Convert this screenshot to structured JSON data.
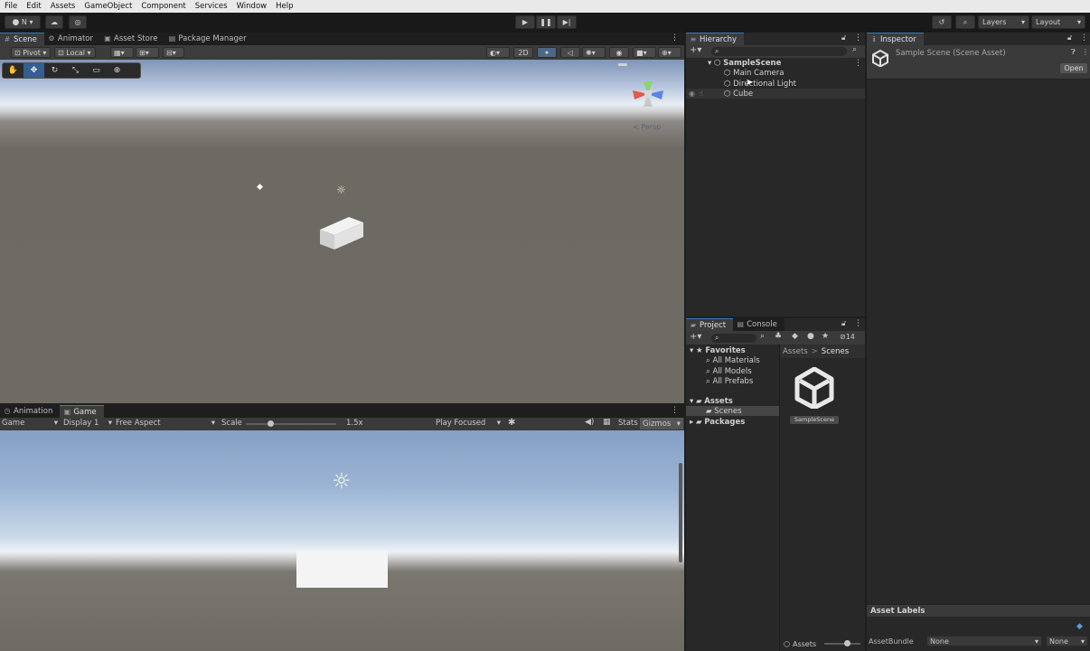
{
  "menu": [
    "File",
    "Edit",
    "Assets",
    "GameObject",
    "Component",
    "Services",
    "Window",
    "Help"
  ],
  "toolbar": {
    "account": "N",
    "layers": "Layers",
    "layout": "Layout"
  },
  "scene_tabs": [
    "Scene",
    "Animator",
    "Asset Store",
    "Package Manager"
  ],
  "scene_toolbar": {
    "pivot": "Pivot",
    "local": "Local",
    "mode_2d": "2D"
  },
  "scene_view": {
    "persp_label": "< Persp"
  },
  "game_tabs": [
    "Animation",
    "Game"
  ],
  "game_toolbar": {
    "game_dropdown": "Game",
    "display": "Display 1",
    "aspect": "Free Aspect",
    "scale_label": "Scale",
    "scale_value": "1.5x",
    "play_focused": "Play Focused",
    "stats": "Stats",
    "gizmos": "Gizmos"
  },
  "hierarchy": {
    "title": "Hierarchy",
    "search_placeholder": "",
    "scene": "SampleScene",
    "items": [
      "Main Camera",
      "Directional Light",
      "Cube"
    ]
  },
  "inspector": {
    "title": "Inspector",
    "asset_title": "Sample Scene (Scene Asset)",
    "open_button": "Open",
    "asset_labels": "Asset Labels",
    "asset_bundle_label": "AssetBundle",
    "asset_bundle_value": "None",
    "asset_bundle_variant": "None"
  },
  "project": {
    "tabs": [
      "Project",
      "Console"
    ],
    "hidden_count": "14",
    "favorites": "Favorites",
    "favorites_items": [
      "All Materials",
      "All Models",
      "All Prefabs"
    ],
    "assets": "Assets",
    "scenes": "Scenes",
    "packages": "Packages",
    "breadcrumb": [
      "Assets",
      "Scenes"
    ],
    "breadcrumb_sep": ">",
    "asset_name": "SampleScene",
    "footer": "Assets"
  },
  "colors": {
    "accent_blue": "#3a79bb",
    "selected_row": "#2c5d87",
    "sky_top": "#8aa3c6",
    "ground": "#6e6a64"
  }
}
